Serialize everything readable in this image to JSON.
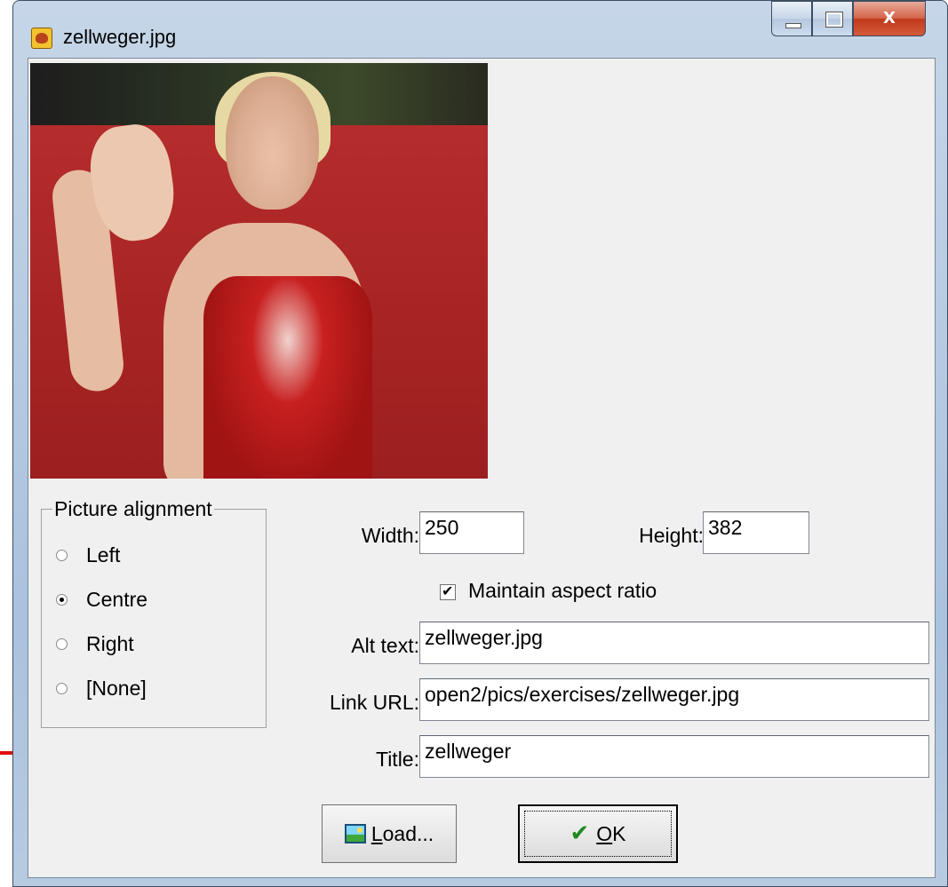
{
  "window": {
    "title": "zellweger.jpg"
  },
  "caption_buttons": {
    "minimize": "minimize",
    "maximize": "maximize",
    "close": "X"
  },
  "alignment": {
    "legend": "Picture alignment",
    "options": [
      {
        "label": "Left",
        "selected": false
      },
      {
        "label": "Centre",
        "selected": true
      },
      {
        "label": "Right",
        "selected": false
      },
      {
        "label": "[None]",
        "selected": false
      }
    ]
  },
  "size": {
    "width_label": "Width:",
    "width_value": "250",
    "height_label": "Height:",
    "height_value": "382",
    "maintain_aspect_label": "Maintain aspect ratio",
    "maintain_aspect_checked": true
  },
  "fields": {
    "alt_label": "Alt text:",
    "alt_value": "zellweger.jpg",
    "link_label": "Link URL:",
    "link_value": "open2/pics/exercises/zellweger.jpg",
    "title_label": "Title:",
    "title_value": "zellweger"
  },
  "buttons": {
    "load_underlined": "L",
    "load_rest": "oad...",
    "ok_underlined": "O",
    "ok_rest": "K"
  },
  "colors": {
    "annotation_arrow": "#e01010",
    "dialog_bg": "#f0f0f0"
  }
}
